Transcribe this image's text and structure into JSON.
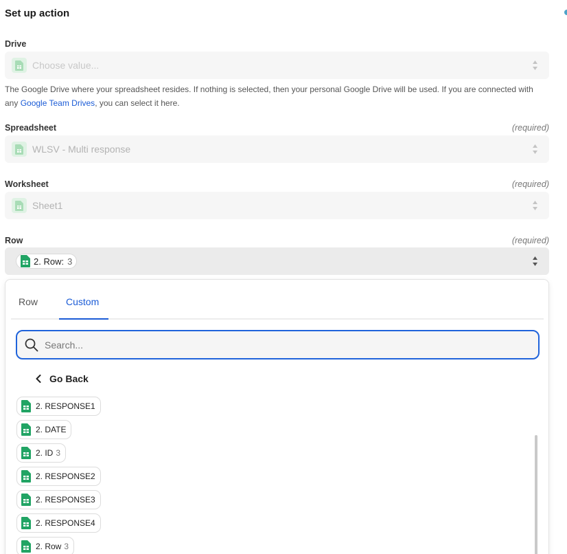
{
  "title": "Set up action",
  "drive": {
    "label": "Drive",
    "placeholder": "Choose value...",
    "help_pre": "The Google Drive where your spreadsheet resides. If nothing is selected, then your personal Google Drive will be used. If you are connected with any ",
    "help_link": "Google Team Drives",
    "help_post": ", you can select it here."
  },
  "spreadsheet": {
    "label": "Spreadsheet",
    "required": "(required)",
    "value": "WLSV - Multi response"
  },
  "worksheet": {
    "label": "Worksheet",
    "required": "(required)",
    "value": "Sheet1"
  },
  "row": {
    "label": "Row",
    "required": "(required)",
    "pill_label": "2. Row:",
    "pill_value": "3"
  },
  "dropdown": {
    "tabs": [
      "Row",
      "Custom"
    ],
    "active_tab": "Custom",
    "search_placeholder": "Search...",
    "go_back": "Go Back",
    "options": [
      {
        "label": "2. RESPONSE1",
        "value": ""
      },
      {
        "label": "2. DATE",
        "value": ""
      },
      {
        "label": "2. ID",
        "value": "3"
      },
      {
        "label": "2. RESPONSE2",
        "value": ""
      },
      {
        "label": "2. RESPONSE3",
        "value": ""
      },
      {
        "label": "2. RESPONSE4",
        "value": ""
      },
      {
        "label": "2. Row",
        "value": "3"
      }
    ]
  },
  "colors": {
    "accent": "#1a5bd6",
    "sheets_green": "#21a464",
    "sheets_green_light": "#dff2e4"
  },
  "icons": {
    "sheet": "google-sheets-icon",
    "arrows": "sort-arrows-icon",
    "search": "search-icon",
    "back": "chevron-left-icon"
  }
}
